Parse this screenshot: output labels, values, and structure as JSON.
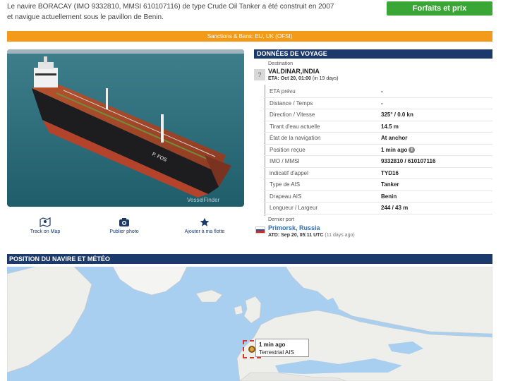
{
  "intro_text": "Le navire BORACAY (IMO 9332810, MMSI 610107116) de type Crude Oil Tanker a été construit en 2007 et navigue actuellement sous le pavillon de Benin.",
  "forfaits_label": "Forfaits et prix",
  "sanctions_text": "Sanctions & Bans: EU, UK (OFSI)",
  "photo": {
    "hull_name": "P. FOS",
    "watermark": "VesselFinder"
  },
  "actions": [
    {
      "label": "Track on Map",
      "icon": "map-pin-icon"
    },
    {
      "label": "Publier photo",
      "icon": "camera-icon"
    },
    {
      "label": "Ajouter à ma flotte",
      "icon": "star-icon"
    }
  ],
  "voyage": {
    "header": "DONNÉES DE VOYAGE",
    "dest_label": "Destination",
    "dest_name": "VALDINAR,INDIA",
    "eta_prefix": "ETA: Oct 20, 01:00",
    "eta_suffix": "(in 19 days)",
    "rows": [
      {
        "label": "ETA prévu",
        "value": "-"
      },
      {
        "label": "Distance / Temps",
        "value": "-"
      },
      {
        "label": "Direction / Vitesse",
        "value": "325° / 0.0 kn"
      },
      {
        "label": "Tirant d'eau actuelle",
        "value": "14.5 m"
      },
      {
        "label": "État de la navigation",
        "value": "At anchor"
      },
      {
        "label": "Position reçue",
        "value": "1 min ago"
      },
      {
        "label": "IMO / MMSI",
        "value": "9332810 / 610107116"
      },
      {
        "label": "indicatif d'appel",
        "value": "TYD16"
      },
      {
        "label": "Type de AIS",
        "value": "Tanker"
      },
      {
        "label": "Drapeau AIS",
        "value": "Benin"
      },
      {
        "label": "Longueur / Largeur",
        "value": "244 / 43 m"
      }
    ],
    "last_port_label": "Dernier port",
    "last_port_name": "Primorsk, Russia",
    "atd_prefix": "ATD: Sep 20, 05:11 UTC",
    "atd_suffix": "(11 days ago)"
  },
  "position": {
    "header": "POSITION DU NAVIRE ET MÉTÉO",
    "tooltip_time": "1 min ago",
    "tooltip_source": "Terrestrial AIS"
  },
  "colors": {
    "brand_navy": "#1b3a6b",
    "cta_green": "#3aa635",
    "sanction_orange": "#f39a1b",
    "link_blue": "#2a6ebb"
  }
}
